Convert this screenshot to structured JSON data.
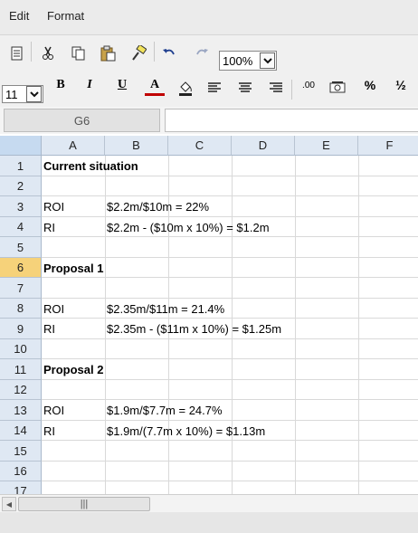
{
  "menu": {
    "edit": "Edit",
    "format": "Format"
  },
  "toolbar": {
    "zoom": "100%",
    "font_size": "11",
    "bold": "B",
    "italic": "I",
    "underline": "U",
    "font_color": "A",
    "decimal": ".00",
    "percent": "%",
    "fraction": "½"
  },
  "name_box": "G6",
  "formula": "",
  "columns": [
    "A",
    "B",
    "C",
    "D",
    "E",
    "F"
  ],
  "rows": [
    "1",
    "2",
    "3",
    "4",
    "5",
    "6",
    "7",
    "8",
    "9",
    "10",
    "11",
    "12",
    "13",
    "14",
    "15",
    "16",
    "17"
  ],
  "active_row": "6",
  "cells": {
    "r1a": "Current situation",
    "r3a": "ROI",
    "r3b": "$2.2m/$10m = 22%",
    "r4a": "RI",
    "r4b": "$2.2m - ($10m x 10%) = $1.2m",
    "r6a": "Proposal 1",
    "r8a": "ROI",
    "r8b": "$2.35m/$11m = 21.4%",
    "r9a": "RI",
    "r9b": "$2.35m - ($11m x 10%) = $1.25m",
    "r11a": "Proposal 2",
    "r13a": "ROI",
    "r13b": "$1.9m/$7.7m = 24.7%",
    "r14a": "RI",
    "r14b": "$1.9m/(7.7m x 10%) = $1.13m"
  },
  "scrollbar": {
    "thumb_grip": "|||"
  },
  "colors": {
    "header_bg": "#dfe8f3",
    "active_row": "#f6d27a",
    "grid": "#d9d9d9"
  }
}
